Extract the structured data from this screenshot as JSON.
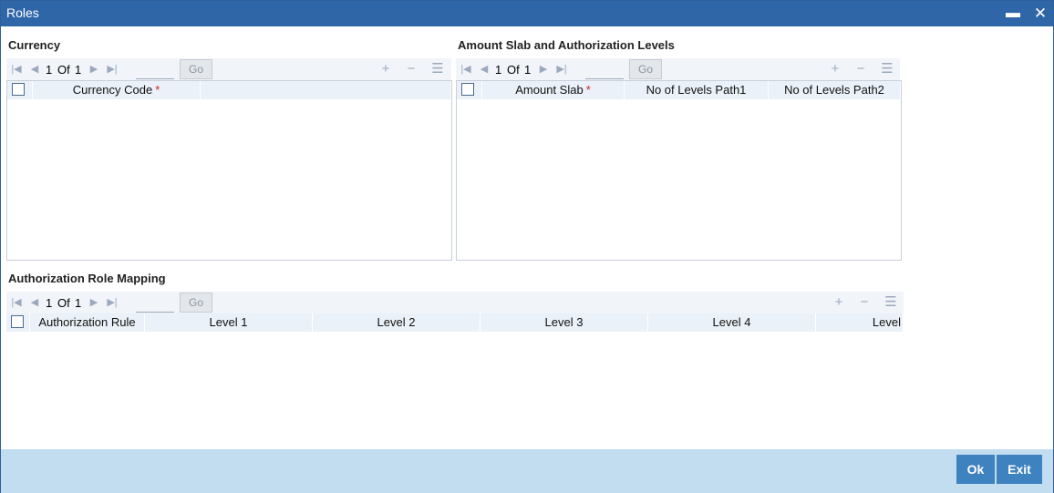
{
  "window": {
    "title": "Roles",
    "minimize_glyph": "▬",
    "close_glyph": "✕"
  },
  "currency": {
    "title": "Currency",
    "pager": {
      "current": "1",
      "of": "Of",
      "total": "1",
      "go": "Go"
    },
    "columns": [
      "Currency Code"
    ],
    "required_mark": "*"
  },
  "amount_slab": {
    "title": "Amount Slab and Authorization Levels",
    "pager": {
      "current": "1",
      "of": "Of",
      "total": "1",
      "go": "Go"
    },
    "columns": [
      "Amount Slab",
      "No of Levels Path1",
      "No of Levels Path2"
    ],
    "required_mark": "*"
  },
  "auth_role": {
    "title": "Authorization Role Mapping",
    "pager": {
      "current": "1",
      "of": "Of",
      "total": "1",
      "go": "Go"
    },
    "columns": [
      "Authorization Rule",
      "Level 1",
      "Level 2",
      "Level 3",
      "Level 4",
      "Level"
    ]
  },
  "icons": {
    "first": "first-page-icon",
    "prev": "previous-page-icon",
    "next": "next-page-icon",
    "last": "last-page-icon",
    "add": "add-row-icon",
    "delete": "delete-row-icon",
    "view": "single-view-icon"
  },
  "footer": {
    "ok": "Ok",
    "exit": "Exit"
  },
  "colors": {
    "titlebar": "#2f66a8",
    "footer": "#c2dcf0",
    "button": "#3e82bf",
    "required": "#d11f1f"
  }
}
